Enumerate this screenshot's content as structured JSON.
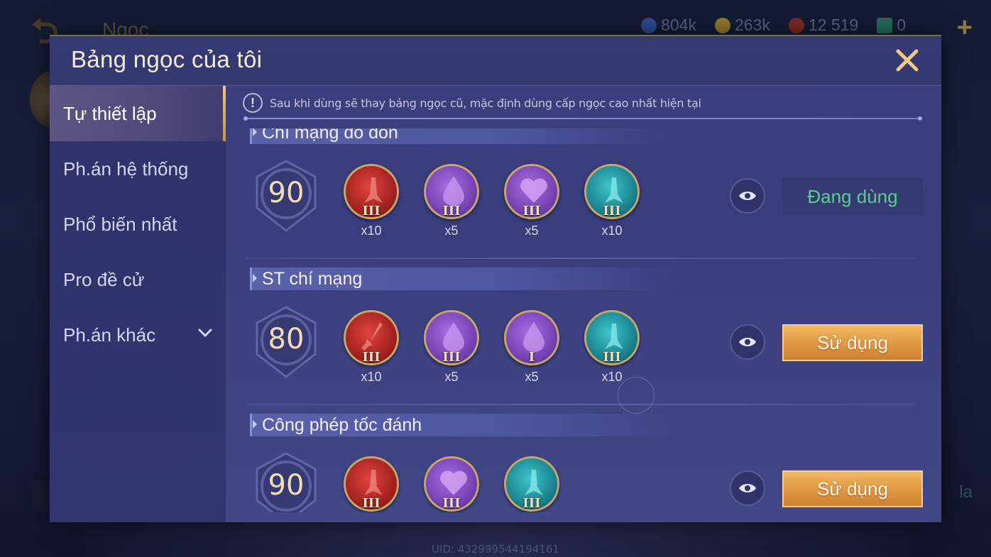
{
  "background": {
    "title": "Ngọc",
    "currencies": [
      {
        "icon": "blue-coin-icon",
        "value": "804k",
        "color": "#3b5fb0"
      },
      {
        "icon": "gold-coin-icon",
        "value": "263k",
        "color": "#c9a23c"
      },
      {
        "icon": "red-gem-icon",
        "value": "12 519",
        "color": "#c7423a"
      },
      {
        "icon": "card-icon",
        "value": "0",
        "color": "#3aa98a"
      }
    ],
    "right_text": "la",
    "uid": "UID: 432999544194161"
  },
  "modal": {
    "title": "Bảng ngọc của tôi",
    "close_icon": "close-icon"
  },
  "sidebar": {
    "items": [
      {
        "label": "Tự thiết lập",
        "active": true
      },
      {
        "label": "Ph.án hệ thống",
        "active": false
      },
      {
        "label": "Phổ biến nhất",
        "active": false
      },
      {
        "label": "Pro đề cử",
        "active": false
      },
      {
        "label": "Ph.án khác",
        "active": false,
        "has_dropdown": true
      }
    ]
  },
  "notice": {
    "text": "Sau khi dùng sẽ thay bảng ngọc cũ, mặc định dùng cấp ngọc cao nhất hiện tại"
  },
  "sets": [
    {
      "name": "Chí mạng dồ dồn",
      "level": "90",
      "gems": [
        {
          "color": "red",
          "symbol": "blade",
          "tier": "III",
          "count": "x10"
        },
        {
          "color": "purple",
          "symbol": "drop",
          "tier": "III",
          "count": "x5"
        },
        {
          "color": "purple",
          "symbol": "heart",
          "tier": "III",
          "count": "x5"
        },
        {
          "color": "teal",
          "symbol": "blade",
          "tier": "III",
          "count": "x10"
        }
      ],
      "action": "Đang dùng",
      "action_state": "using"
    },
    {
      "name": "ST chí mạng",
      "level": "80",
      "gems": [
        {
          "color": "red",
          "symbol": "sword",
          "tier": "III",
          "count": "x10"
        },
        {
          "color": "purple",
          "symbol": "drop",
          "tier": "III",
          "count": "x5"
        },
        {
          "color": "purple",
          "symbol": "drop",
          "tier": "I",
          "count": "x5"
        },
        {
          "color": "teal",
          "symbol": "blade",
          "tier": "III",
          "count": "x10"
        }
      ],
      "action": "Sử dụng",
      "action_state": "use"
    },
    {
      "name": "Công phép tốc đánh",
      "level": "90",
      "gems": [
        {
          "color": "red",
          "symbol": "blade",
          "tier": "III",
          "count": ""
        },
        {
          "color": "purple",
          "symbol": "heart",
          "tier": "III",
          "count": ""
        },
        {
          "color": "teal",
          "symbol": "blade",
          "tier": "III",
          "count": ""
        }
      ],
      "action": "Sử dụng",
      "action_state": "use"
    }
  ],
  "colors": {
    "accent_gold": "#e5a24c",
    "using_green": "#57d08c",
    "modal_bg": "#3b3f7d"
  }
}
